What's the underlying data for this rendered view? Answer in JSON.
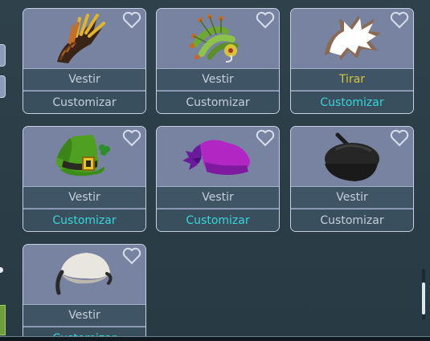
{
  "items": [
    {
      "name": "mohawk-hat",
      "wear": "Vestir",
      "custom": "Customizar",
      "equipped": false,
      "customized": false
    },
    {
      "name": "feather-headdress",
      "wear": "Vestir",
      "custom": "Customizar",
      "equipped": false,
      "customized": false
    },
    {
      "name": "white-spiky-hair",
      "wear": "Tirar",
      "custom": "Customizar",
      "equipped": true,
      "customized": true
    },
    {
      "name": "leprechaun-hat",
      "wear": "Vestir",
      "custom": "Customizar",
      "equipped": false,
      "customized": true
    },
    {
      "name": "magenta-cap",
      "wear": "Vestir",
      "custom": "Customizar",
      "equipped": false,
      "customized": true
    },
    {
      "name": "black-beret",
      "wear": "Vestir",
      "custom": "Customizar",
      "equipped": false,
      "customized": false
    },
    {
      "name": "white-helmet-cap",
      "wear": "Vestir",
      "custom": "Customizar",
      "equipped": false,
      "customized": true
    }
  ],
  "colors": {
    "default_text": "#c5cfdc",
    "wear_active": "#d5c53a",
    "custom_active": "#37d4dc",
    "card_bg": "#7883a0"
  },
  "icons": {
    "favorite": "heart-outline-icon"
  }
}
